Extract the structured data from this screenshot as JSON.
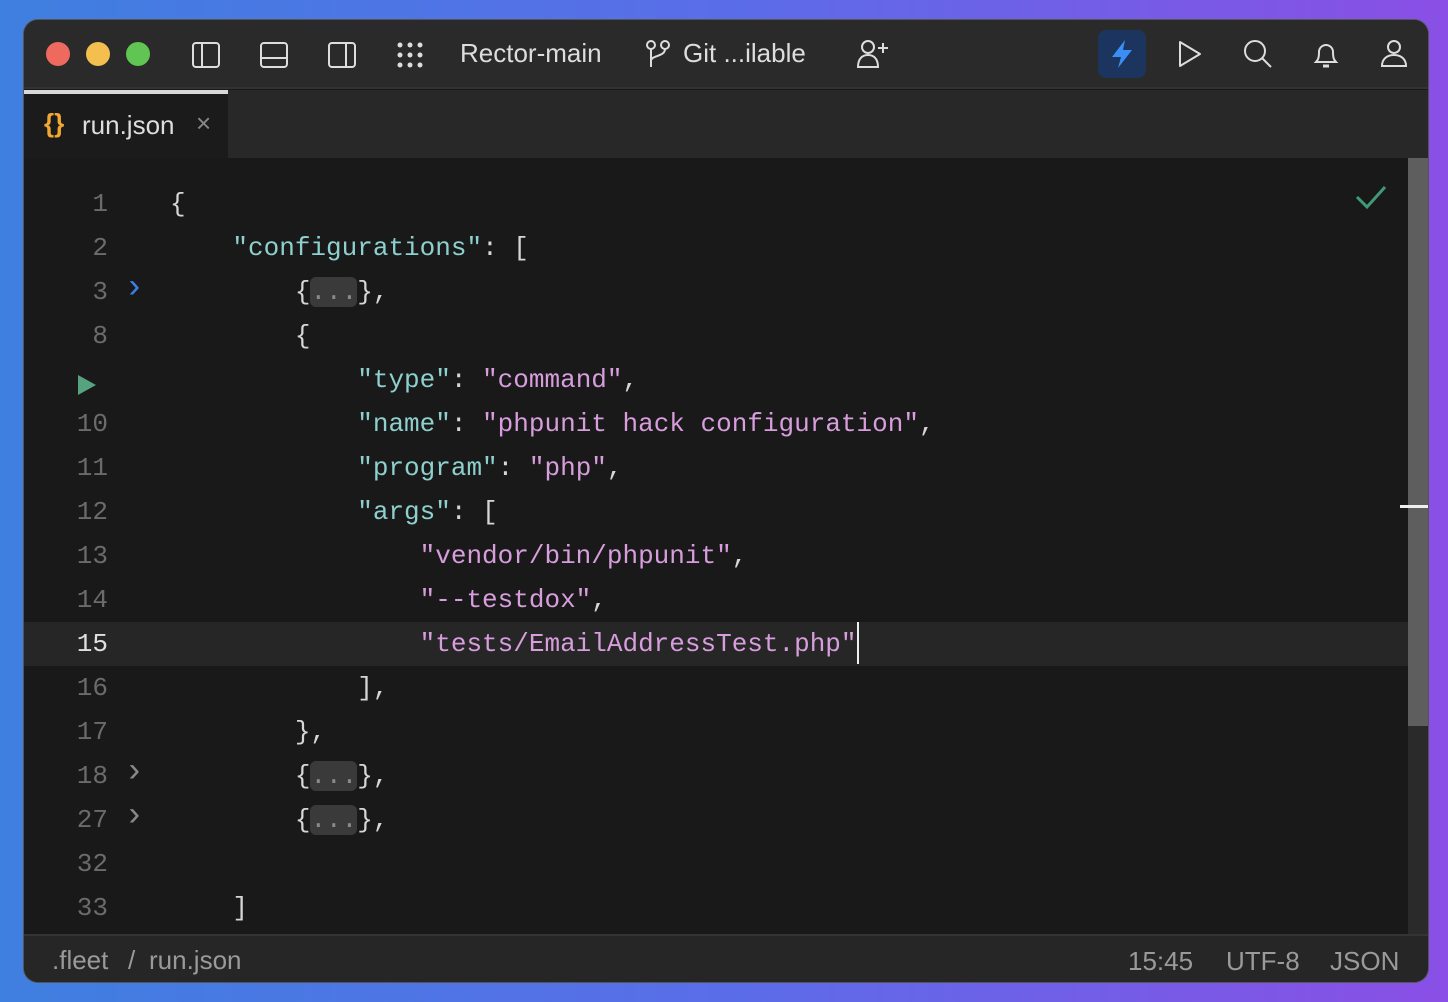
{
  "titlebar": {
    "project": "Rector-main",
    "git": "Git ...ilable"
  },
  "tab": {
    "label": "run.json"
  },
  "colors": {
    "accent": "#3a8ef6",
    "key": "#8dd0cd",
    "string": "#d79ddc",
    "ok": "#3f9a78"
  },
  "lines": [
    {
      "num": "1",
      "fold": "",
      "tokens": [
        {
          "t": "{",
          "c": "p"
        }
      ]
    },
    {
      "num": "2",
      "fold": "",
      "tokens": [
        {
          "t": "    "
        },
        {
          "t": "\"configurations\"",
          "c": "k"
        },
        {
          "t": ": [",
          "c": "p"
        }
      ]
    },
    {
      "num": "3",
      "fold": "blue",
      "tokens": [
        {
          "t": "        {",
          "c": "p"
        },
        {
          "t": "...",
          "c": "coll"
        },
        {
          "t": "},",
          "c": "p"
        }
      ]
    },
    {
      "num": "8",
      "fold": "",
      "tokens": [
        {
          "t": "        {",
          "c": "p"
        }
      ]
    },
    {
      "num": "",
      "fold": "",
      "run": true,
      "tokens": [
        {
          "t": "            "
        },
        {
          "t": "\"type\"",
          "c": "k"
        },
        {
          "t": ": ",
          "c": "p"
        },
        {
          "t": "\"command\"",
          "c": "s"
        },
        {
          "t": ",",
          "c": "p"
        }
      ]
    },
    {
      "num": "10",
      "fold": "",
      "tokens": [
        {
          "t": "            "
        },
        {
          "t": "\"name\"",
          "c": "k"
        },
        {
          "t": ": ",
          "c": "p"
        },
        {
          "t": "\"phpunit hack configuration\"",
          "c": "s"
        },
        {
          "t": ",",
          "c": "p"
        }
      ]
    },
    {
      "num": "11",
      "fold": "",
      "tokens": [
        {
          "t": "            "
        },
        {
          "t": "\"program\"",
          "c": "k"
        },
        {
          "t": ": ",
          "c": "p"
        },
        {
          "t": "\"php\"",
          "c": "s"
        },
        {
          "t": ",",
          "c": "p"
        }
      ]
    },
    {
      "num": "12",
      "fold": "",
      "tokens": [
        {
          "t": "            "
        },
        {
          "t": "\"args\"",
          "c": "k"
        },
        {
          "t": ": [",
          "c": "p"
        }
      ]
    },
    {
      "num": "13",
      "fold": "",
      "tokens": [
        {
          "t": "                "
        },
        {
          "t": "\"vendor/bin/phpunit\"",
          "c": "s"
        },
        {
          "t": ",",
          "c": "p"
        }
      ]
    },
    {
      "num": "14",
      "fold": "",
      "tokens": [
        {
          "t": "                "
        },
        {
          "t": "\"--testdox\"",
          "c": "s"
        },
        {
          "t": ",",
          "c": "p"
        }
      ]
    },
    {
      "num": "15",
      "fold": "",
      "current": true,
      "tokens": [
        {
          "t": "                "
        },
        {
          "t": "\"tests/EmailAddressTest.php\"",
          "c": "s"
        }
      ]
    },
    {
      "num": "16",
      "fold": "",
      "tokens": [
        {
          "t": "            ],",
          "c": "p"
        }
      ]
    },
    {
      "num": "17",
      "fold": "",
      "tokens": [
        {
          "t": "        },",
          "c": "p"
        }
      ]
    },
    {
      "num": "18",
      "fold": "grey",
      "tokens": [
        {
          "t": "        {",
          "c": "p"
        },
        {
          "t": "...",
          "c": "coll"
        },
        {
          "t": "},",
          "c": "p"
        }
      ]
    },
    {
      "num": "27",
      "fold": "grey",
      "tokens": [
        {
          "t": "        {",
          "c": "p"
        },
        {
          "t": "...",
          "c": "coll"
        },
        {
          "t": "},",
          "c": "p"
        }
      ]
    },
    {
      "num": "32",
      "fold": "",
      "tokens": []
    },
    {
      "num": "33",
      "fold": "",
      "tokens": [
        {
          "t": "    ]",
          "c": "p"
        }
      ]
    }
  ],
  "status": {
    "folder": ".fleet",
    "sep": "/",
    "file": "run.json",
    "position": "15:45",
    "encoding": "UTF-8",
    "language": "JSON"
  }
}
